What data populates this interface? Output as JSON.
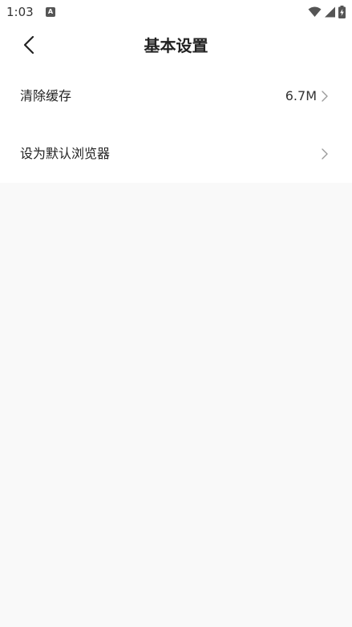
{
  "status_bar": {
    "time": "1:03",
    "app_icon_letter": "A"
  },
  "header": {
    "title": "基本设置"
  },
  "settings": {
    "items": [
      {
        "label": "清除缓存",
        "value": "6.7M"
      },
      {
        "label": "设为默认浏览器",
        "value": ""
      }
    ]
  },
  "colors": {
    "background": "#f9f9f9",
    "surface": "#ffffff",
    "text_primary": "#222222",
    "chevron": "#9a9a9a"
  }
}
